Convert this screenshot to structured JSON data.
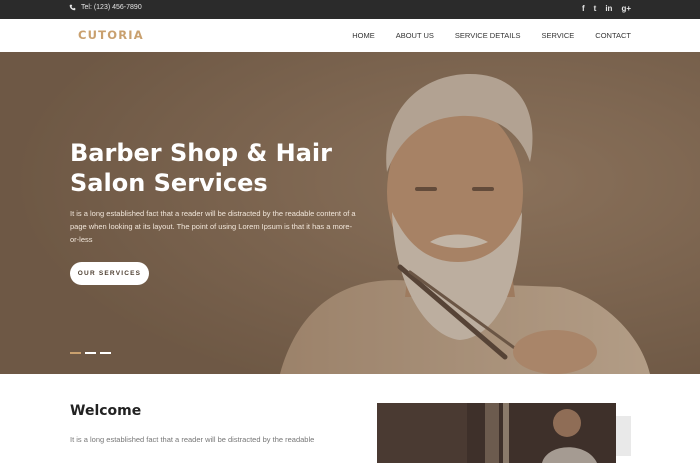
{
  "topbar": {
    "phone": "Tel: (123) 456-7890",
    "social": [
      {
        "icon": "facebook-icon",
        "glyph": "f"
      },
      {
        "icon": "twitter-icon",
        "glyph": "t"
      },
      {
        "icon": "linkedin-icon",
        "glyph": "in"
      },
      {
        "icon": "google-plus-icon",
        "glyph": "g+"
      }
    ]
  },
  "brand": {
    "logo": "CUTORIA",
    "accent_color": "#c9a06e"
  },
  "nav": {
    "items": [
      "HOME",
      "ABOUT US",
      "SERVICE DETAILS",
      "SERVICE",
      "CONTACT"
    ]
  },
  "hero": {
    "title_line1": "Barber Shop & Hair",
    "title_line2": "Salon Services",
    "text": "It is a long established fact that a reader will be distracted by the readable content of a page when looking at its layout. The point of using Lorem Ipsum is that it has a more-or-less",
    "button": "OUR SERVICES",
    "overlay_color": "#7d6651",
    "slides_total": 3,
    "active_slide": 1
  },
  "welcome": {
    "title": "Welcome",
    "text": "It is a long established fact that a reader will be distracted by the readable"
  }
}
